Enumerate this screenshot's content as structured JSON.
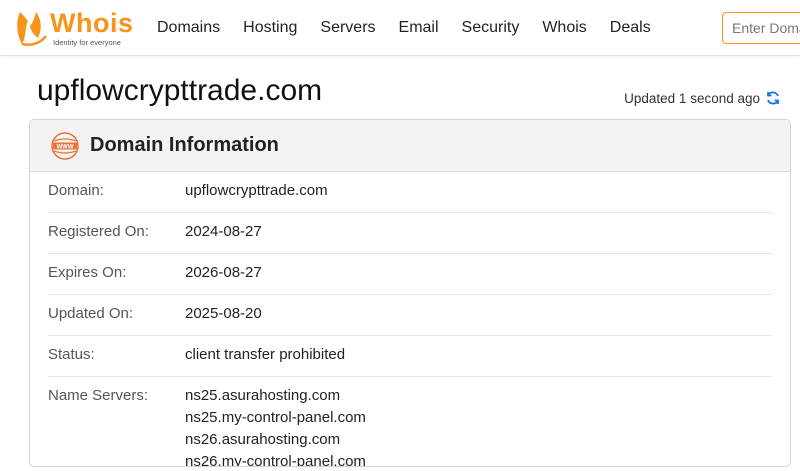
{
  "header": {
    "logo": {
      "word": "Whois",
      "tagline": "Identity for everyone"
    },
    "nav": [
      {
        "label": "Domains"
      },
      {
        "label": "Hosting"
      },
      {
        "label": "Servers"
      },
      {
        "label": "Email"
      },
      {
        "label": "Security"
      },
      {
        "label": "Whois"
      },
      {
        "label": "Deals"
      }
    ],
    "search": {
      "placeholder": "Enter Domain or IP",
      "value": ""
    }
  },
  "page": {
    "title": "upflowcrypttrade.com",
    "updated": "Updated 1 second ago",
    "refresh_icon": "refresh-icon"
  },
  "card": {
    "icon": "www-icon",
    "title": "Domain Information",
    "rows": [
      {
        "label": "Domain:",
        "value": "upflowcrypttrade.com"
      },
      {
        "label": "Registered On:",
        "value": "2024-08-27"
      },
      {
        "label": "Expires On:",
        "value": "2026-08-27"
      },
      {
        "label": "Updated On:",
        "value": "2025-08-20"
      },
      {
        "label": "Status:",
        "value": "client transfer prohibited"
      }
    ],
    "name_servers": {
      "label": "Name Servers:",
      "values": [
        "ns25.asurahosting.com",
        "ns25.my-control-panel.com",
        "ns26.asurahosting.com",
        "ns26.my-control-panel.com"
      ]
    }
  },
  "colors": {
    "brand": "#f7941d",
    "refresh": "#1a73e8"
  }
}
